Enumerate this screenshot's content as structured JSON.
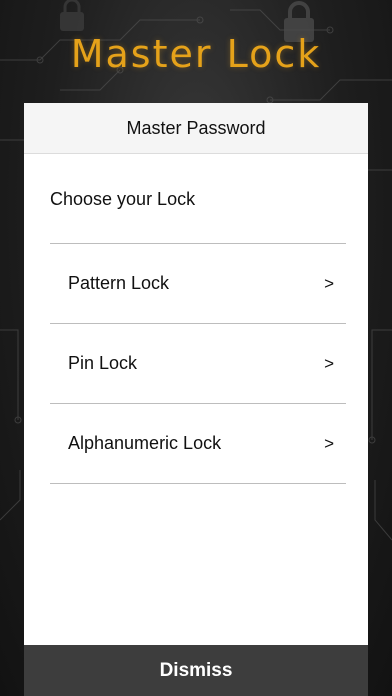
{
  "app": {
    "title": "Master Lock",
    "accent_color": "#e5a21a"
  },
  "dialog": {
    "title": "Master Password",
    "section_label": "Choose your Lock",
    "options": [
      {
        "label": "Pattern Lock",
        "chevron": ">"
      },
      {
        "label": "Pin Lock",
        "chevron": ">"
      },
      {
        "label": "Alphanumeric Lock",
        "chevron": ">"
      }
    ],
    "dismiss_label": "Dismiss"
  },
  "icons": {
    "background": "padlock-icon",
    "option_arrow": "chevron-right-icon"
  }
}
